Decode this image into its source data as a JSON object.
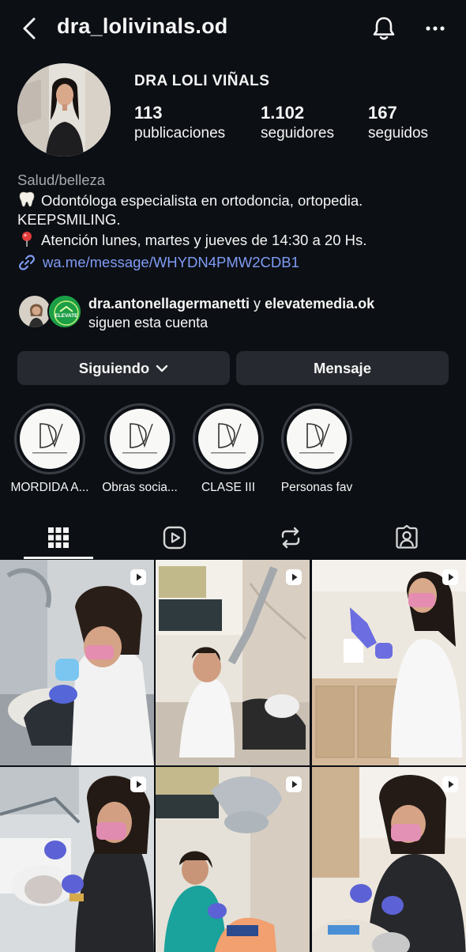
{
  "header": {
    "username": "dra_lolivinals.od"
  },
  "profile": {
    "display_name": "DRA LOLI VIÑALS",
    "stats": [
      {
        "value": "113",
        "label": "publicaciones"
      },
      {
        "value": "1.102",
        "label": "seguidores"
      },
      {
        "value": "167",
        "label": "seguidos"
      }
    ],
    "category": "Salud/belleza",
    "bio_lines": [
      "Odontóloga especialista en ortodoncia, ortopedia.",
      "KEEPSMILING.",
      "Atención lunes, martes y jueves de 14:30 a 20 Hs."
    ],
    "bio_emojis": [
      "tooth-icon",
      "pin-icon"
    ],
    "link": "wa.me/message/WHYDN4PMW2CDB1"
  },
  "followed_by": {
    "user1": "dra.antonellagermanetti",
    "connector": " y ",
    "user2": "elevatemedia.ok",
    "suffix": "siguen esta cuenta",
    "avatar2_text": "ELEVATE"
  },
  "actions": {
    "following_label": "Siguiendo",
    "message_label": "Mensaje"
  },
  "highlights": [
    {
      "label": "MORDIDA A..."
    },
    {
      "label": "Obras socia..."
    },
    {
      "label": "CLASE III"
    },
    {
      "label": "Personas fav"
    }
  ],
  "highlight_logo": "DV",
  "tabs": [
    "grid-icon",
    "reels-icon",
    "reposts-icon",
    "tagged-icon"
  ],
  "colors": {
    "background": "#0c0f14",
    "button": "#26292f",
    "link": "#7f9cf5",
    "secondary_text": "#a7a9ad"
  }
}
